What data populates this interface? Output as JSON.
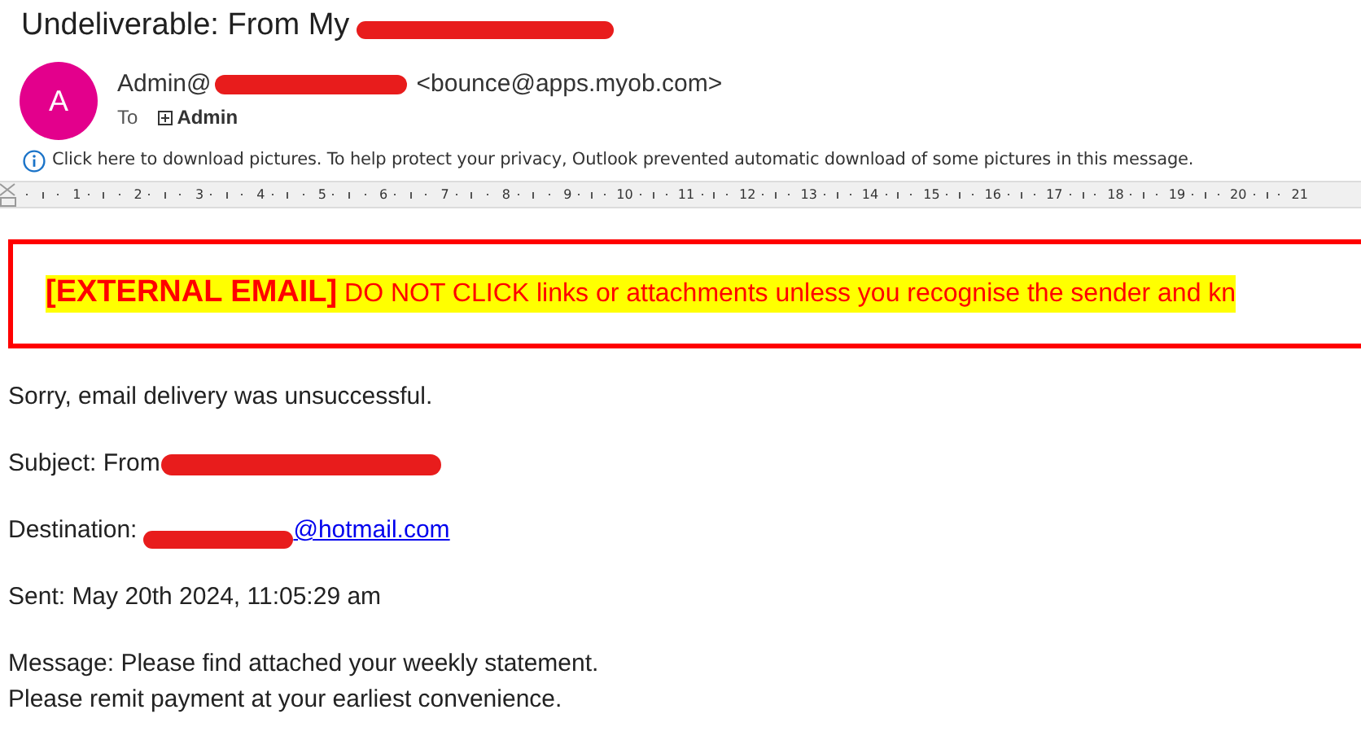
{
  "subject": {
    "text": "Undeliverable: From My",
    "redacted": true
  },
  "sender": {
    "initial": "A",
    "name": "Admin@",
    "redacted": true,
    "address": "<bounce@apps.myob.com>",
    "to_label": "To",
    "recipient": "Admin"
  },
  "info_bar": "Click here to download pictures. To help protect your privacy, Outlook prevented automatic download of some pictures in this message.",
  "ruler": [
    "1",
    "2",
    "3",
    "4",
    "5",
    "6",
    "7",
    "8",
    "9",
    "10",
    "11",
    "12",
    "13",
    "14",
    "15",
    "16",
    "17",
    "18",
    "19",
    "20",
    "21"
  ],
  "banner": {
    "tag": "[EXTERNAL EMAIL]",
    "text": "DO NOT CLICK links or attachments unless you recognise the sender and kn"
  },
  "body": [
    {
      "kind": "text",
      "text": "Sorry, email delivery was unsuccessful."
    },
    {
      "kind": "redacted",
      "label": "Subject: From"
    },
    {
      "kind": "link",
      "label": "Destination:",
      "link": "@hotmail.com"
    },
    {
      "kind": "text",
      "text": "Sent: May 20th 2024, 11:05:29 am"
    },
    {
      "kind": "lines",
      "lines": [
        "Message: Please find attached your weekly statement.",
        "Please remit payment at your earliest convenience."
      ]
    }
  ]
}
